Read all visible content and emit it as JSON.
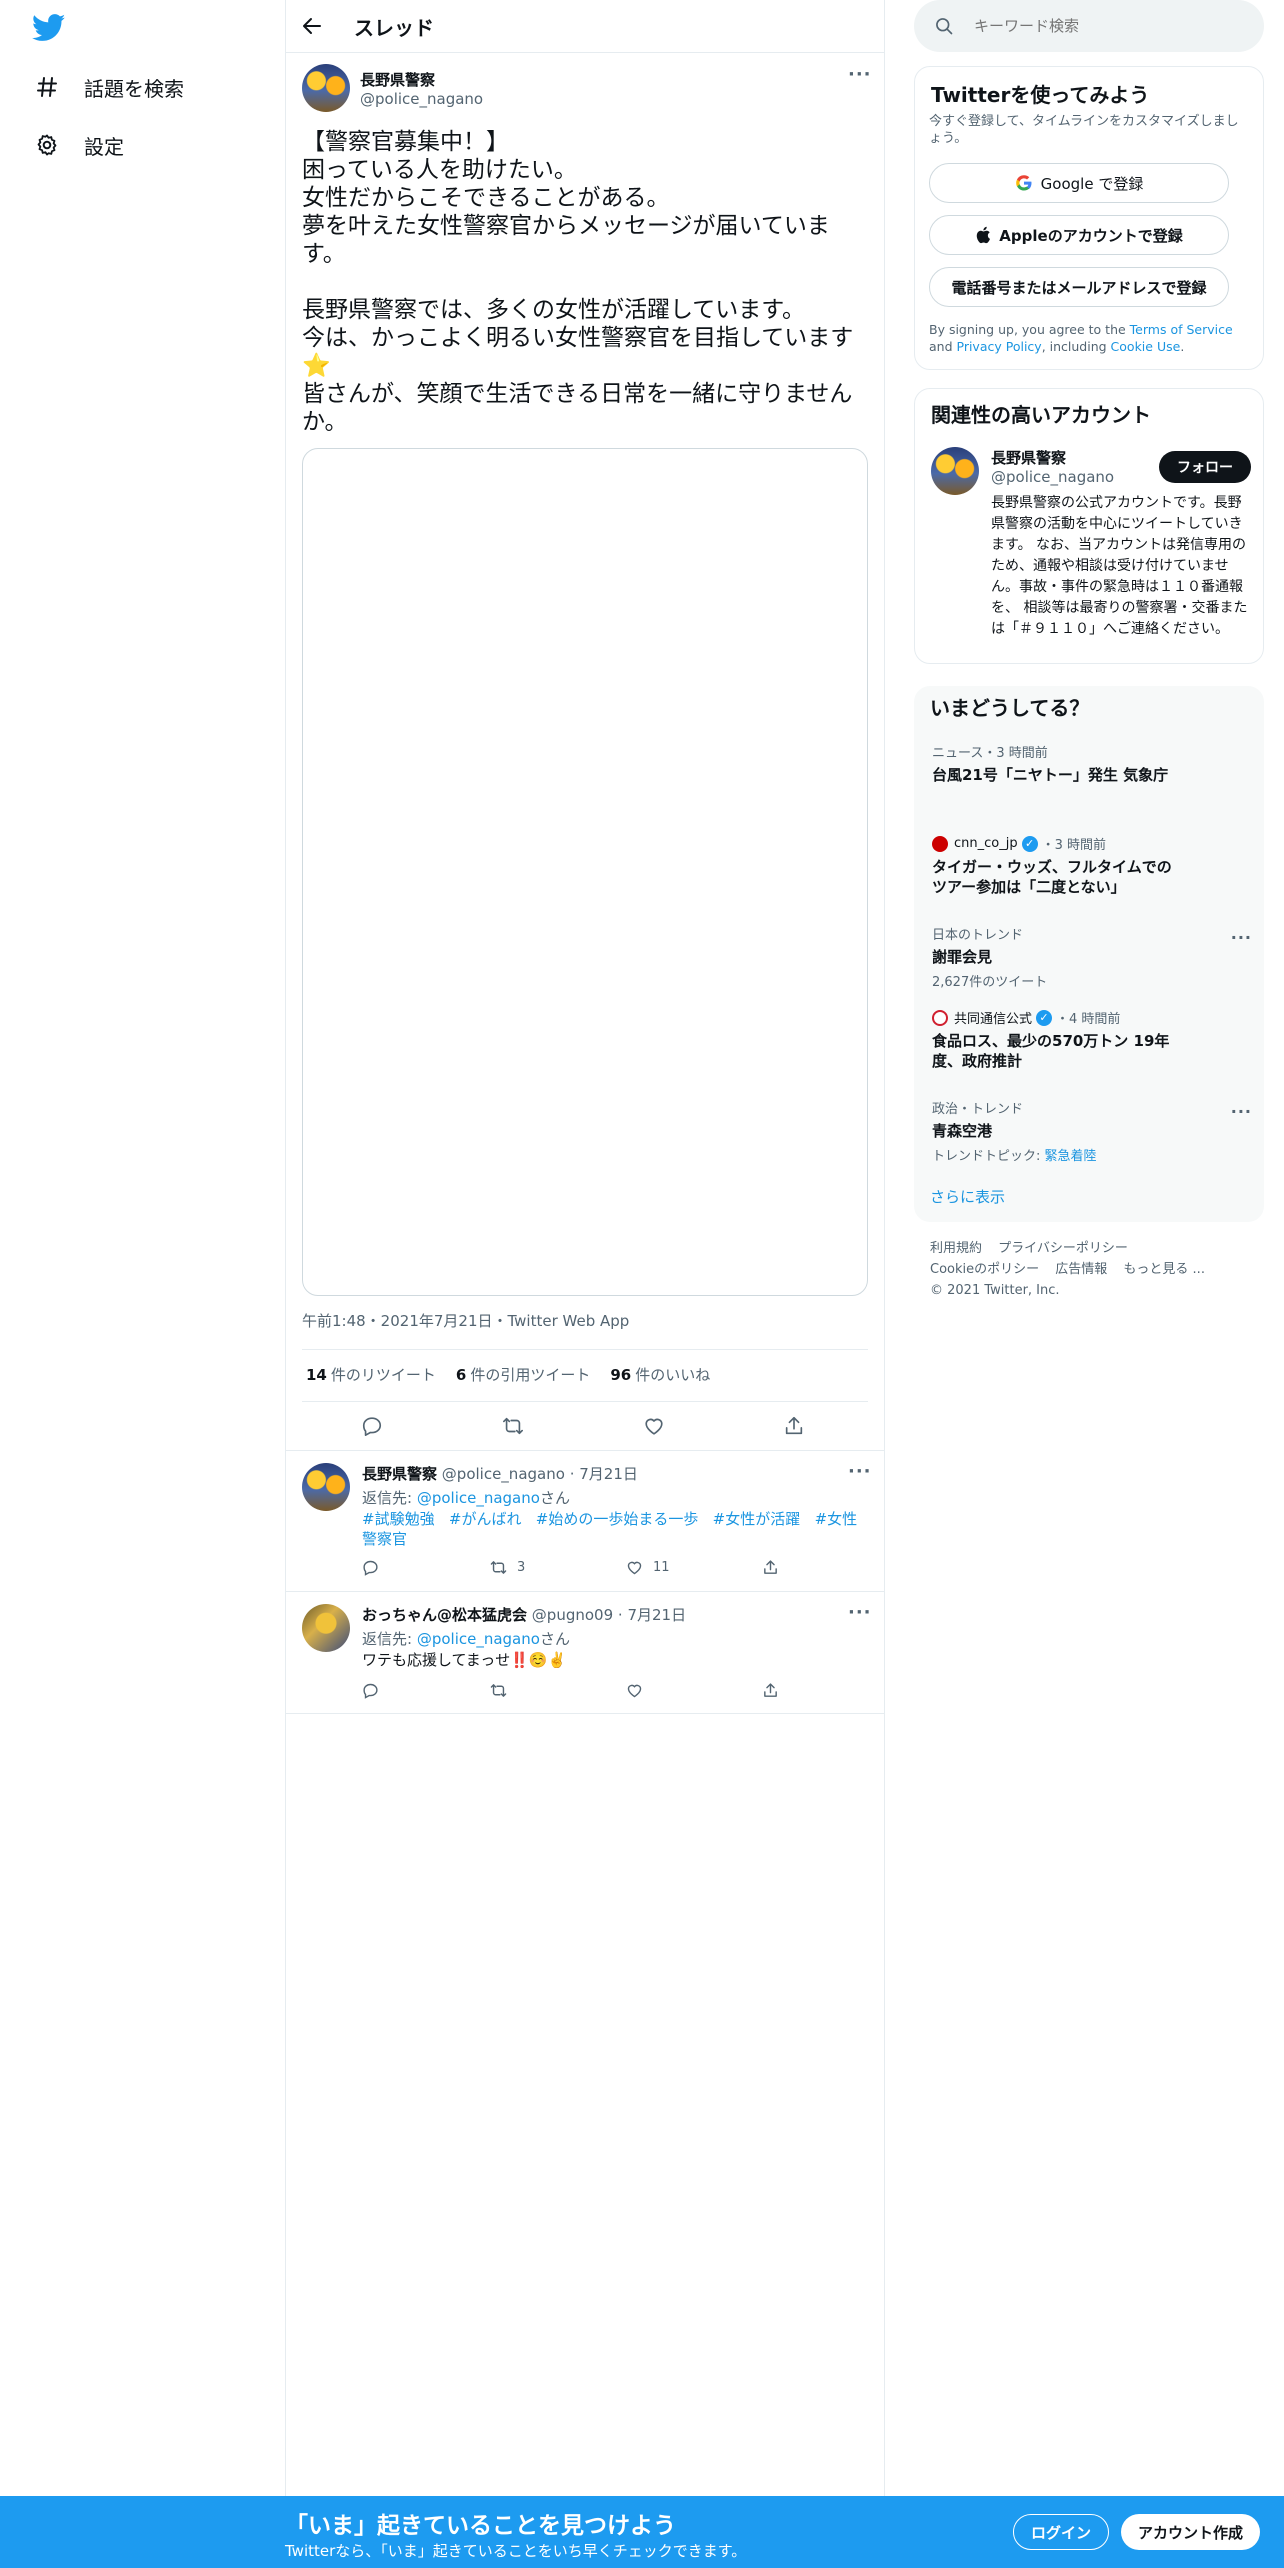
{
  "nav": {
    "logo": "twitter-bird",
    "items": [
      {
        "label": "話題を検索",
        "icon": "hashtag-icon"
      },
      {
        "label": "設定",
        "icon": "gear-icon"
      }
    ]
  },
  "header": {
    "title": "スレッド"
  },
  "main_tweet": {
    "display_name": "長野県警察",
    "handle": "@police_nagano",
    "text_lines": [
      "【警察官募集中！】",
      "困っている人を助けたい。",
      "女性だからこそできることがある。",
      "夢を叶えた女性警察官からメッセージが届いています。",
      "",
      "長野県警察では、多くの女性が活躍しています。",
      "今は、かっこよく明るい女性警察官を目指しています⭐",
      "皆さんが、笑顔で生活できる日常を一緒に守りませんか。"
    ],
    "meta": "午前1:48・2021年7月21日・Twitter Web App",
    "stats": {
      "retweets": "14",
      "retweets_label": "件のリツイート",
      "quotes": "6",
      "quotes_label": "件の引用ツイート",
      "likes": "96",
      "likes_label": "件のいいね"
    }
  },
  "replies": [
    {
      "display_name": "長野県警察",
      "handle": "@police_nagano",
      "date": "7月21日",
      "reply_prefix": "返信先: ",
      "reply_to": "@police_nagano",
      "reply_suffix": "さん",
      "hashtags": [
        "#試験勉強",
        "#がんばれ",
        "#始めの一歩始まる一歩",
        "#女性が活躍",
        "#女性警察官"
      ],
      "retweets": "3",
      "likes": "11"
    },
    {
      "display_name": "おっちゃん@松本猛虎会",
      "handle": "@pugno09",
      "date": "7月21日",
      "reply_prefix": "返信先: ",
      "reply_to": "@police_nagano",
      "reply_suffix": "さん",
      "text": "ワテも応援してまっせ‼️☺️✌️",
      "retweets": "",
      "likes": ""
    }
  ],
  "search": {
    "placeholder": "キーワード検索"
  },
  "signup_card": {
    "title": "Twitterを使ってみよう",
    "subtitle": "今すぐ登録して、タイムラインをカスタマイズしましょう。",
    "google": "Google で登録",
    "apple": "Appleのアカウントで登録",
    "phone": "電話番号またはメールアドレスで登録",
    "legal_1": "By signing up, you agree to the ",
    "tos": "Terms of Service",
    "legal_2": " and ",
    "privacy": "Privacy Policy",
    "legal_3": ", including ",
    "cookie": "Cookie Use",
    "legal_4": "."
  },
  "related": {
    "title": "関連性の高いアカウント",
    "display_name": "長野県警察",
    "handle": "@police_nagano",
    "follow": "フォロー",
    "bio": "長野県警察の公式アカウントです。長野県警察の活動を中心にツイートしていきます。 なお、当アカウントは発信専用のため、通報や相談は受け付けていません。事故・事件の緊急時は１１０番通報を、 相談等は最寄りの警察署・交番または「＃９１１０」へご連絡ください。"
  },
  "trends": {
    "title": "いまどうしてる？",
    "items": [
      {
        "category": "ニュース・3 時間前",
        "title": "台風21号「ニヤトー」発生 気象庁"
      },
      {
        "source": "cnn_co_jp",
        "category": "・3 時間前",
        "title": "タイガー・ウッズ、フルタイムでのツアー参加は「二度とない」"
      },
      {
        "category": "日本のトレンド",
        "title": "謝罪会見",
        "sub": "2,627件のツイート"
      },
      {
        "source": "共同通信公式",
        "category": "・4 時間前",
        "title": "食品ロス、最少の570万トン 19年度、政府推計"
      },
      {
        "category": "政治・トレンド",
        "title": "青森空港",
        "sub_prefix": "トレンドトピック: ",
        "sub_link": "緊急着陸"
      }
    ],
    "show_more": "さらに表示"
  },
  "footer": {
    "links": [
      "利用規約",
      "プライバシーポリシー",
      "Cookieのポリシー",
      "広告情報",
      "もっと見る ..."
    ],
    "copyright": "© 2021 Twitter, Inc."
  },
  "bottom_bar": {
    "title": "「いま」起きていることを見つけよう",
    "subtitle": "Twitterなら、「いま」起きていることをいち早くチェックできます。",
    "login": "ログイン",
    "signup": "アカウント作成"
  },
  "colors": {
    "accent": "#1d9bf0",
    "link": "#1b95e0",
    "text": "#0f1419",
    "muted": "#536471"
  }
}
